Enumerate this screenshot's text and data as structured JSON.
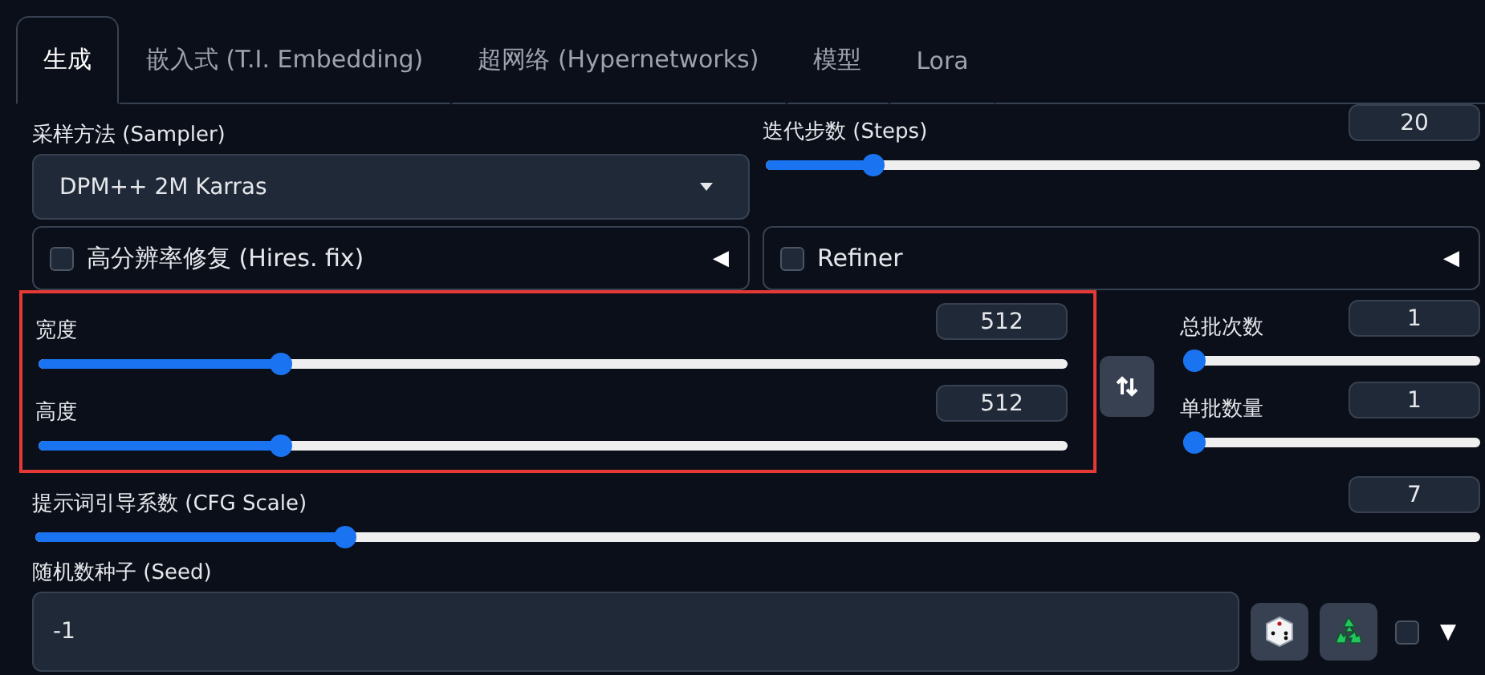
{
  "tabs": [
    {
      "label": "生成",
      "selected": true
    },
    {
      "label": "嵌入式 (T.I. Embedding)",
      "selected": false
    },
    {
      "label": "超网络 (Hypernetworks)",
      "selected": false
    },
    {
      "label": "模型",
      "selected": false
    },
    {
      "label": "Lora",
      "selected": false
    }
  ],
  "sampler": {
    "label": "采样方法 (Sampler)",
    "value": "DPM++ 2M Karras"
  },
  "steps": {
    "label": "迭代步数 (Steps)",
    "value": "20",
    "level": 0.14
  },
  "accordions": [
    {
      "label": "高分辨率修复 (Hires. fix)",
      "checked": false,
      "icon": "◀"
    },
    {
      "label": "Refiner",
      "checked": false,
      "icon": "◀"
    }
  ],
  "size": [
    {
      "label": "宽度",
      "value": "512",
      "level": 0.23
    },
    {
      "label": "高度",
      "value": "512",
      "level": 0.23
    }
  ],
  "batch": [
    {
      "label": "总批次数",
      "value": "1",
      "level": 0
    },
    {
      "label": "单批数量",
      "value": "1",
      "level": 0
    }
  ],
  "cfg": {
    "label": "提示词引导系数 (CFG Scale)",
    "value": "7",
    "level": 0.21
  },
  "seed": {
    "label": "随机数种子 (Seed)",
    "value": "-1",
    "extra_checked": false,
    "toggle": "▼"
  }
}
